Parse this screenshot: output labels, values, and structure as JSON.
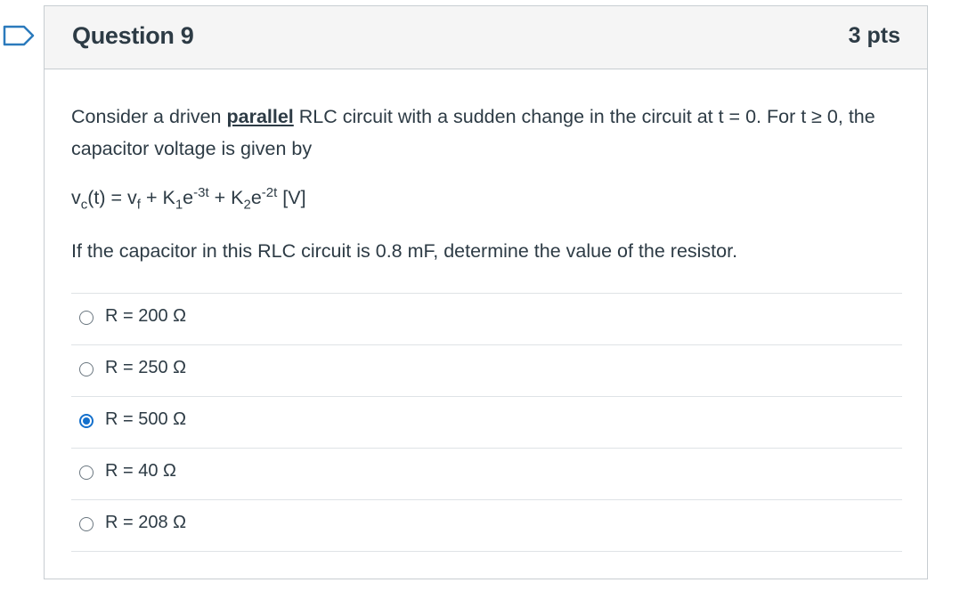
{
  "question": {
    "title": "Question 9",
    "points": "3 pts",
    "text_part1": "Consider a driven ",
    "text_emph": "parallel",
    "text_part2": " RLC circuit with a sudden change in the circuit at t = 0.  For t ≥ 0, the capacitor voltage is given by",
    "formula": {
      "v": "v",
      "v_sub": "c",
      "mid1": "(t) = v",
      "vf_sub": "f",
      "mid2": " + K",
      "k1_sub": "1",
      "e1": "e",
      "exp1": "-3t",
      "mid3": " + K",
      "k2_sub": "2",
      "e2": "e",
      "exp2": "-2t",
      "unit": " [V]"
    },
    "prompt": "If the capacitor in this RLC circuit is 0.8 mF, determine the value of the resistor."
  },
  "answers": [
    {
      "label": "R = 200 Ω",
      "selected": false
    },
    {
      "label": "R = 250 Ω",
      "selected": false
    },
    {
      "label": "R = 500 Ω",
      "selected": true
    },
    {
      "label": "R = 40 Ω",
      "selected": false
    },
    {
      "label": "R = 208 Ω",
      "selected": false
    }
  ],
  "colors": {
    "accent": "#1470cc",
    "header_bg": "#f5f5f5",
    "text": "#2d3b45",
    "flag": "#2b7abc"
  }
}
